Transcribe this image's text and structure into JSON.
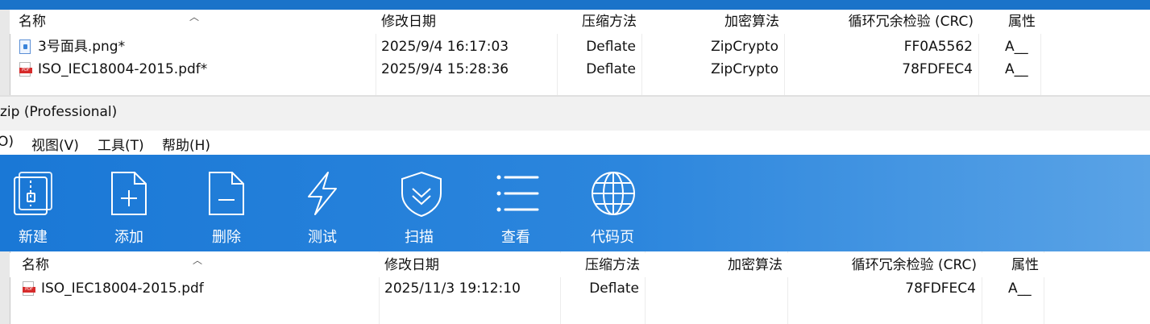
{
  "archive_list_top": {
    "columns": {
      "name": "名称",
      "modified": "修改日期",
      "method": "压缩方法",
      "encryption": "加密算法",
      "crc": "循环冗余检验 (CRC)",
      "attributes": "属性"
    },
    "rows": [
      {
        "icon": "png-file-icon",
        "name": "3号面具.png*",
        "modified": "2025/9/4 16:17:03",
        "method": "Deflate",
        "encryption": "ZipCrypto",
        "crc": "FF0A5562",
        "attributes": "A__"
      },
      {
        "icon": "pdf-file-icon",
        "name": "ISO_IEC18004-2015.pdf*",
        "modified": "2025/9/4 15:28:36",
        "method": "Deflate",
        "encryption": "ZipCrypto",
        "crc": "78FDFEC4",
        "attributes": "A__"
      }
    ]
  },
  "window": {
    "title": "zip (Professional)"
  },
  "menu": {
    "items": [
      "O)",
      "视图(V)",
      "工具(T)",
      "帮助(H)"
    ]
  },
  "toolbar": {
    "buttons": [
      {
        "label": "新建",
        "icon": "new-archive-icon"
      },
      {
        "label": "添加",
        "icon": "add-file-icon"
      },
      {
        "label": "删除",
        "icon": "delete-file-icon"
      },
      {
        "label": "测试",
        "icon": "test-lightning-icon"
      },
      {
        "label": "扫描",
        "icon": "scan-shield-icon"
      },
      {
        "label": "查看",
        "icon": "view-list-icon"
      },
      {
        "label": "代码页",
        "icon": "codepage-globe-icon"
      }
    ],
    "colors": {
      "start": "#1a78d6",
      "end": "#5aa3e6",
      "icon": "#ffffff"
    }
  },
  "archive_list_bottom": {
    "columns": {
      "name": "名称",
      "modified": "修改日期",
      "method": "压缩方法",
      "encryption": "加密算法",
      "crc": "循环冗余检验 (CRC)",
      "attributes": "属性"
    },
    "rows": [
      {
        "icon": "pdf-file-icon",
        "name": "ISO_IEC18004-2015.pdf",
        "modified": "2025/11/3 19:12:10",
        "method": "Deflate",
        "encryption": "",
        "crc": "78FDFEC4",
        "attributes": "A__"
      }
    ]
  }
}
